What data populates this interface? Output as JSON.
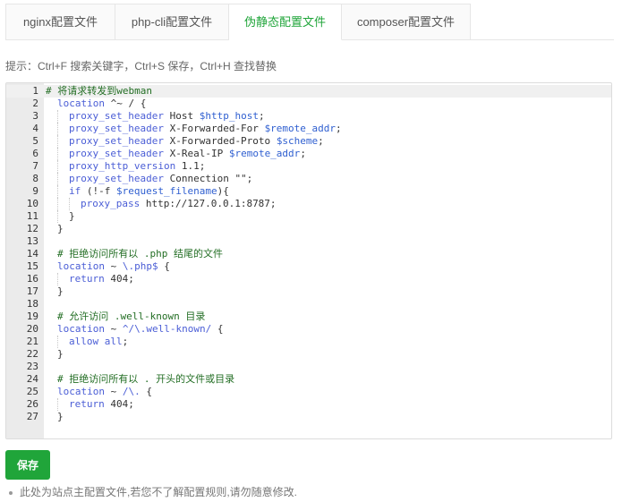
{
  "tabs": [
    {
      "label": "nginx配置文件"
    },
    {
      "label": "php-cli配置文件"
    },
    {
      "label": "伪静态配置文件"
    },
    {
      "label": "composer配置文件"
    }
  ],
  "active_tab": 2,
  "hint": "提示：Ctrl+F 搜索关键字，Ctrl+S 保存，Ctrl+H 查找替换",
  "editor": {
    "lines": [
      {
        "num": "1",
        "text": "# 将请求转发到webman"
      },
      {
        "num": "2",
        "text": "location ^~ / {"
      },
      {
        "num": "3",
        "text": "proxy_set_header Host $http_host;"
      },
      {
        "num": "4",
        "text": "proxy_set_header X-Forwarded-For $remote_addr;"
      },
      {
        "num": "5",
        "text": "proxy_set_header X-Forwarded-Proto $scheme;"
      },
      {
        "num": "6",
        "text": "proxy_set_header X-Real-IP $remote_addr;"
      },
      {
        "num": "7",
        "text": "proxy_http_version 1.1;"
      },
      {
        "num": "8",
        "text": "proxy_set_header Connection \"\";"
      },
      {
        "num": "9",
        "text": "if (!-f $request_filename){"
      },
      {
        "num": "10",
        "text": "proxy_pass http://127.0.0.1:8787;"
      },
      {
        "num": "11",
        "text": "}"
      },
      {
        "num": "12",
        "text": "}"
      },
      {
        "num": "13",
        "text": ""
      },
      {
        "num": "14",
        "text": "# 拒绝访问所有以 .php 结尾的文件"
      },
      {
        "num": "15",
        "text": "location ~ \\.php$ {"
      },
      {
        "num": "16",
        "text": "return 404;"
      },
      {
        "num": "17",
        "text": "}"
      },
      {
        "num": "18",
        "text": ""
      },
      {
        "num": "19",
        "text": "# 允许访问 .well-known 目录"
      },
      {
        "num": "20",
        "text": "location ~ ^/\\.well-known/ {"
      },
      {
        "num": "21",
        "text": "allow all;"
      },
      {
        "num": "22",
        "text": "}"
      },
      {
        "num": "23",
        "text": ""
      },
      {
        "num": "24",
        "text": "# 拒绝访问所有以 . 开头的文件或目录"
      },
      {
        "num": "25",
        "text": "location ~ /\\. {"
      },
      {
        "num": "26",
        "text": "return 404;"
      },
      {
        "num": "27",
        "text": "}"
      }
    ]
  },
  "save_button": {
    "label": "保存"
  },
  "note": "此处为站点主配置文件,若您不了解配置规则,请勿随意修改.",
  "colors": {
    "accent": "#20a53a",
    "comment": "#236e24",
    "keyword": "#4b5ed6",
    "variable": "#2f5fd0"
  }
}
